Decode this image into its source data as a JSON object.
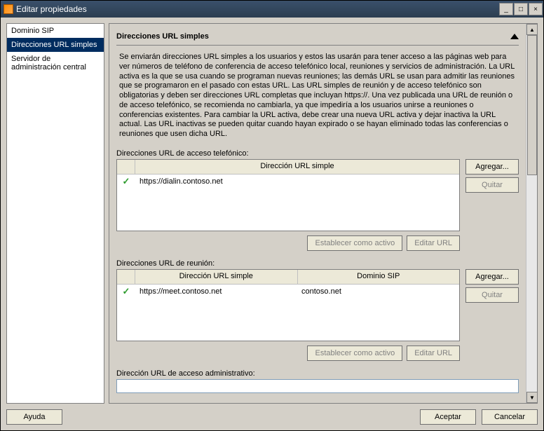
{
  "window": {
    "title": "Editar propiedades"
  },
  "sidebar": {
    "items": [
      {
        "label": "Dominio SIP",
        "selected": false
      },
      {
        "label": "Direcciones URL simples",
        "selected": true
      },
      {
        "label": "Servidor de administración central",
        "selected": false
      }
    ]
  },
  "section": {
    "title": "Direcciones URL simples",
    "description": "Se enviarán direcciones URL simples a los usuarios y estos las usarán para tener acceso a las páginas web para ver números de teléfono de conferencia de acceso telefónico local, reuniones y servicios de administración. La URL activa es la que se usa cuando se programan nuevas reuniones; las demás URL se usan para admitir las reuniones que se programaron en el pasado con estas URL. Las URL simples de reunión y de acceso telefónico son obligatorias y deben ser direcciones URL completas que incluyan https://. Una vez publicada una URL de reunión o de acceso telefónico, se recomienda no cambiarla, ya que impediría a los usuarios unirse a reuniones o conferencias existentes. Para cambiar la URL activa, debe crear una nueva URL activa y dejar inactiva la URL actual. Las URL inactivas se pueden quitar cuando hayan expirado o se hayan eliminado todas las conferencias o reuniones que usen dicha URL."
  },
  "dialin": {
    "label": "Direcciones URL de acceso telefónico:",
    "header_url": "Dirección URL simple",
    "rows": [
      {
        "active": true,
        "url": "https://dialin.contoso.net"
      }
    ],
    "add": "Agregar...",
    "remove": "Quitar",
    "set_active": "Establecer como activo",
    "edit": "Editar URL"
  },
  "meet": {
    "label": "Direcciones URL de reunión:",
    "header_url": "Dirección URL simple",
    "header_domain": "Dominio SIP",
    "rows": [
      {
        "active": true,
        "url": "https://meet.contoso.net",
        "domain": "contoso.net"
      }
    ],
    "add": "Agregar...",
    "remove": "Quitar",
    "set_active": "Establecer como activo",
    "edit": "Editar URL"
  },
  "admin": {
    "label": "Dirección URL de acceso administrativo:",
    "value": ""
  },
  "footer": {
    "help": "Ayuda",
    "ok": "Aceptar",
    "cancel": "Cancelar"
  }
}
